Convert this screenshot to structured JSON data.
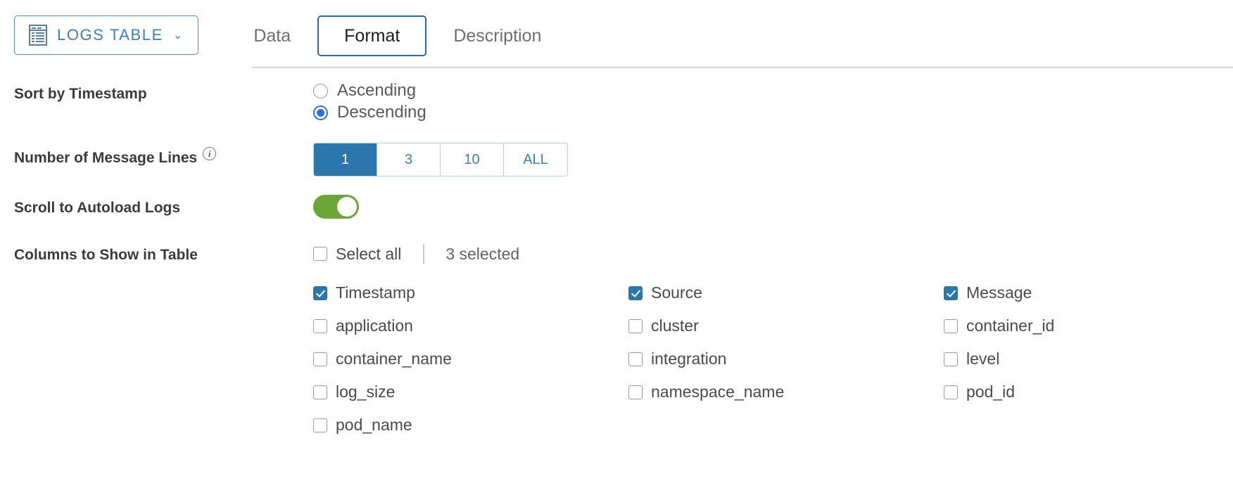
{
  "header": {
    "source_chip": {
      "icon": "table-list-icon",
      "label": "LOGS TABLE",
      "caret": "⌄"
    },
    "tabs": [
      {
        "label": "Data",
        "active": false
      },
      {
        "label": "Format",
        "active": true
      },
      {
        "label": "Description",
        "active": false
      }
    ]
  },
  "settings": {
    "sort": {
      "label": "Sort by Timestamp",
      "options": [
        {
          "label": "Ascending",
          "selected": false
        },
        {
          "label": "Descending",
          "selected": true
        }
      ]
    },
    "message_lines": {
      "label": "Number of Message Lines",
      "info_icon": "info-circle-icon",
      "info_glyph": "i",
      "options": [
        {
          "label": "1",
          "active": true
        },
        {
          "label": "3",
          "active": false
        },
        {
          "label": "10",
          "active": false
        },
        {
          "label": "ALL",
          "active": false
        }
      ]
    },
    "autoload": {
      "label": "Scroll to Autoload Logs",
      "enabled": true
    },
    "columns": {
      "label": "Columns to Show in Table",
      "select_all_label": "Select all",
      "select_all_checked": false,
      "selected_count_text": "3 selected",
      "items": [
        {
          "label": "Timestamp",
          "checked": true
        },
        {
          "label": "Source",
          "checked": true
        },
        {
          "label": "Message",
          "checked": true
        },
        {
          "label": "application",
          "checked": false
        },
        {
          "label": "cluster",
          "checked": false
        },
        {
          "label": "container_id",
          "checked": false
        },
        {
          "label": "container_name",
          "checked": false
        },
        {
          "label": "integration",
          "checked": false
        },
        {
          "label": "level",
          "checked": false
        },
        {
          "label": "log_size",
          "checked": false
        },
        {
          "label": "namespace_name",
          "checked": false
        },
        {
          "label": "pod_id",
          "checked": false
        },
        {
          "label": "pod_name",
          "checked": false
        }
      ]
    }
  },
  "colors": {
    "accent_blue": "#2b77ab",
    "link_blue": "#3c7fc0",
    "focus_blue": "#2769c4",
    "radio_blue": "#2f6fe4",
    "toggle_green": "#6ba637"
  }
}
